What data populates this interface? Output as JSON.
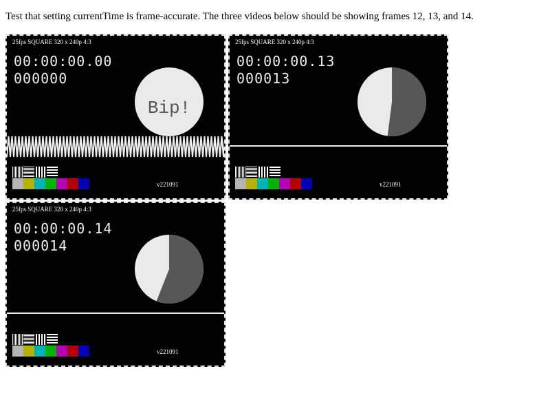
{
  "intro_text": "Test that setting currentTime is frame-accurate. The three videos below should be showing frames 12, 13, and 14.",
  "videos": [
    {
      "header": "25fps SQUARE 320 x 240p 4:3",
      "timecode": "00:00:00.00",
      "frame_label": "000000",
      "frame": 0,
      "indicator": "bip",
      "bip_text": "Bip!",
      "version": "v221091"
    },
    {
      "header": "25fps SQUARE 320 x 240p 4:3",
      "timecode": "00:00:00.13",
      "frame_label": "000013",
      "frame": 13,
      "indicator": "pie",
      "version": "v221091"
    },
    {
      "header": "25fps SQUARE 320 x 240p 4:3",
      "timecode": "00:00:00.14",
      "frame_label": "000014",
      "frame": 14,
      "indicator": "pie",
      "version": "v221091"
    }
  ],
  "fps": 25,
  "colors": {
    "pie_light": "#eaeaea",
    "pie_dark": "#575757",
    "bars": [
      "#b4b4b4",
      "#b4b400",
      "#00b4b4",
      "#00b400",
      "#b400b4",
      "#b40000",
      "#0000b4"
    ]
  }
}
